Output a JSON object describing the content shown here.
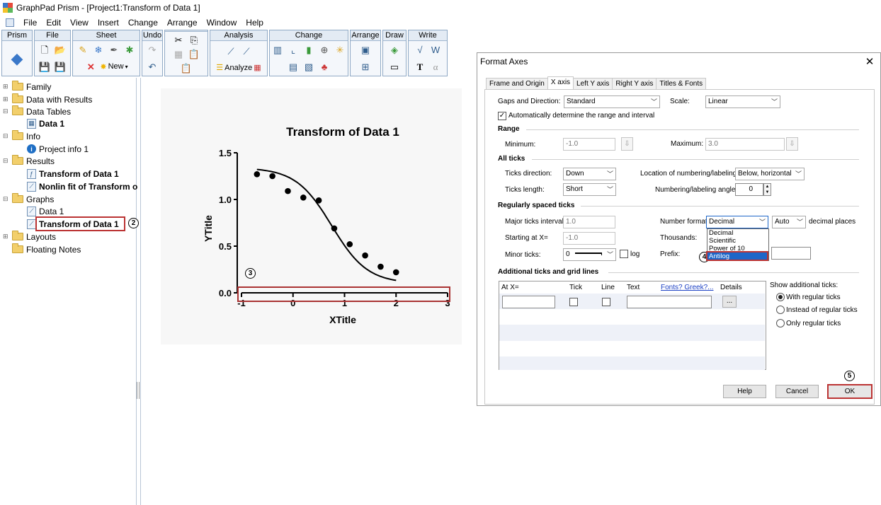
{
  "window": {
    "title": "GraphPad Prism - [Project1:Transform of Data 1]"
  },
  "menu": [
    "File",
    "Edit",
    "View",
    "Insert",
    "Change",
    "Arrange",
    "Window",
    "Help"
  ],
  "ribbon": {
    "groups": [
      "Prism",
      "File",
      "Sheet",
      "Undo",
      "Clipboard",
      "Analysis",
      "Change",
      "Arrange",
      "Draw",
      "Write"
    ],
    "new_label": "New",
    "analyze_label": "Analyze"
  },
  "navigator": {
    "family": "Family",
    "data_with_results": "Data with Results",
    "data_tables": "Data Tables",
    "data_1": "Data 1",
    "info": "Info",
    "project_info": "Project info 1",
    "results": "Results",
    "transform": "Transform of Data 1",
    "nonlin": "Nonlin fit of Transform o",
    "graphs": "Graphs",
    "graph_data1": "Data 1",
    "graph_transform": "Transform of Data 1",
    "layouts": "Layouts",
    "floating_notes": "Floating Notes"
  },
  "callouts": {
    "c2": "2",
    "c3": "3",
    "c4": "4",
    "c5": "5"
  },
  "chart_data": {
    "type": "scatter",
    "title": "Transform of Data 1",
    "xlabel": "XTitle",
    "ylabel": "YTitle",
    "xlim": [
      -1,
      3
    ],
    "ylim": [
      0,
      1.5
    ],
    "x_ticks": [
      "-1",
      "0",
      "1",
      "2",
      "3"
    ],
    "y_ticks": [
      "0.0",
      "0.5",
      "1.0",
      "1.5"
    ],
    "points": [
      {
        "x": -0.7,
        "y": 1.27
      },
      {
        "x": -0.4,
        "y": 1.25
      },
      {
        "x": -0.1,
        "y": 1.09
      },
      {
        "x": 0.2,
        "y": 1.02
      },
      {
        "x": 0.5,
        "y": 0.99
      },
      {
        "x": 0.8,
        "y": 0.69
      },
      {
        "x": 1.1,
        "y": 0.52
      },
      {
        "x": 1.4,
        "y": 0.4
      },
      {
        "x": 1.7,
        "y": 0.28
      },
      {
        "x": 2.0,
        "y": 0.22
      }
    ],
    "curve": {
      "top": 1.34,
      "bottom": 0.1,
      "logEC50": 0.75,
      "hill": -1.25
    },
    "grid": false
  },
  "dialog": {
    "title": "Format Axes",
    "tabs": [
      "Frame and Origin",
      "X axis",
      "Left Y axis",
      "Right Y axis",
      "Titles & Fonts"
    ],
    "gaps_label": "Gaps and Direction:",
    "gaps_value": "Standard",
    "scale_label": "Scale:",
    "scale_value": "Linear",
    "auto_range_label": "Automatically determine the range and interval",
    "range_section": "Range",
    "minimum_label": "Minimum:",
    "minimum_value": "-1.0",
    "maximum_label": "Maximum:",
    "maximum_value": "3.0",
    "all_ticks_section": "All ticks",
    "ticks_direction_label": "Ticks direction:",
    "ticks_direction_value": "Down",
    "location_label": "Location of numbering/labeling:",
    "location_value": "Below, horizontal",
    "ticks_length_label": "Ticks length:",
    "ticks_length_value": "Short",
    "angle_label": "Numbering/labeling angle:",
    "angle_value": "0",
    "regular_section": "Regularly spaced ticks",
    "major_interval_label": "Major ticks interval:",
    "major_interval_value": "1.0",
    "number_format_label": "Number format:",
    "number_format_value": "Decimal",
    "decimal_places_value": "Auto",
    "decimal_places_label": "decimal places",
    "starting_label": "Starting at X=",
    "starting_value": "-1.0",
    "thousands_label": "Thousands:",
    "minor_ticks_label": "Minor ticks:",
    "minor_ticks_value": "0",
    "log_label": "log",
    "prefix_label": "Prefix:",
    "number_format_options": [
      "Decimal",
      "Scientific",
      "Power of 10",
      "Antilog"
    ],
    "selected_option": "Antilog",
    "additional_section": "Additional ticks and grid lines",
    "grid_headers": [
      "At X=",
      "Tick",
      "Line",
      "Text",
      "Fonts? Greek?...",
      "Details"
    ],
    "details_button": "...",
    "show_additional_label": "Show additional ticks:",
    "radio_options": [
      "With regular ticks",
      "Instead of regular ticks",
      "Only regular ticks"
    ],
    "help_button": "Help",
    "cancel_button": "Cancel",
    "ok_button": "OK"
  }
}
